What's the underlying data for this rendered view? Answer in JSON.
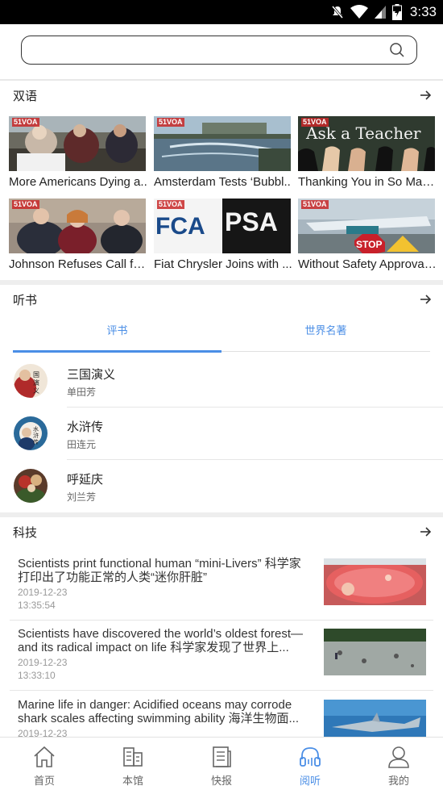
{
  "status_bar": {
    "time": "3:33"
  },
  "search": {
    "placeholder": ""
  },
  "bilingual": {
    "title": "双语",
    "items": [
      {
        "caption": "More Americans Dying a..",
        "badge": "51VOA"
      },
      {
        "caption": "Amsterdam Tests ‘Bubbl..",
        "badge": "51VOA"
      },
      {
        "caption": "Thanking You in So Many..",
        "badge": "51VOA",
        "image_text": "Ask a Teacher"
      },
      {
        "caption": "Johnson Refuses Call fo...",
        "badge": "51VOA"
      },
      {
        "caption": "Fiat Chrysler Joins with ...",
        "badge": "51VOA",
        "image_text_1": "FCA",
        "image_text_2": "PSA"
      },
      {
        "caption": "Without Safety Approval...",
        "badge": "51VOA",
        "image_text": "STOP"
      }
    ]
  },
  "audiobooks": {
    "title": "听书",
    "tabs": [
      {
        "label": "评书",
        "active": true
      },
      {
        "label": "世界名著",
        "active": false
      }
    ],
    "items": [
      {
        "name": "三国演义",
        "author": "单田芳"
      },
      {
        "name": "水浒传",
        "author": "田连元"
      },
      {
        "name": "呼延庆",
        "author": "刘兰芳"
      }
    ]
  },
  "tech": {
    "title": "科技",
    "items": [
      {
        "headline": "Scientists print functional human “mini-Livers” 科学家打印出了功能正常的人类“迷你肝脏”",
        "date": "2019-12-23",
        "time": "13:35:54"
      },
      {
        "headline": "Scientists have discovered the world’s oldest forest—and its radical impact on life 科学家发现了世界上...",
        "date": "2019-12-23",
        "time": "13:33:10"
      },
      {
        "headline": "Marine life in danger: Acidified oceans may corrode shark scales affecting swimming ability 海洋生物面...",
        "date": "2019-12-23",
        "time": ""
      }
    ]
  },
  "bottom_nav": [
    {
      "label": "首页",
      "icon": "home-icon",
      "active": false
    },
    {
      "label": "本馆",
      "icon": "library-icon",
      "active": false
    },
    {
      "label": "快报",
      "icon": "news-icon",
      "active": false
    },
    {
      "label": "阅听",
      "icon": "headphones-icon",
      "active": true
    },
    {
      "label": "我的",
      "icon": "user-icon",
      "active": false
    }
  ],
  "colors": {
    "accent": "#4a8ee6",
    "divider": "#eeeeee"
  }
}
